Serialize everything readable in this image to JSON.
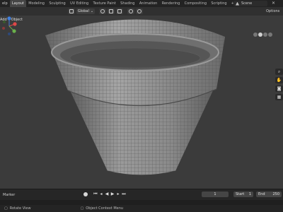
{
  "topbar": {
    "menu_left": "elp",
    "tabs": [
      "Layout",
      "Modeling",
      "Sculpting",
      "UV Editing",
      "Texture Paint",
      "Shading",
      "Animation",
      "Rendering",
      "Compositing",
      "Scripting"
    ],
    "active_tab": "Layout",
    "plus": "+",
    "scene": "Scene"
  },
  "toolbar": {
    "transform_orientation": "Global"
  },
  "viewport_header": {
    "add": "Add",
    "object": "Object",
    "options": "Options"
  },
  "timeline": {
    "marker": "Marker",
    "current_frame": "1",
    "start_label": "Start",
    "start": "1",
    "end_label": "End",
    "end": "250"
  },
  "statusbar": {
    "left": "Rotate View",
    "right": "Object Context Menu"
  },
  "colors": {
    "axis_x": "#e04848",
    "axis_y": "#6ab04c",
    "axis_z": "#3f7fe0",
    "mesh_fill": "#8a8a8a",
    "wire": "#5a5a5a"
  }
}
